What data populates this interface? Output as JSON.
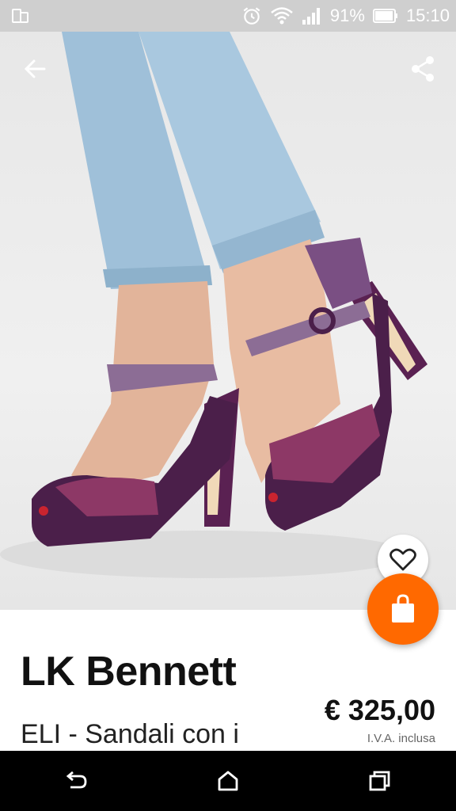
{
  "status_bar": {
    "battery_percent": "91%",
    "time": "15:10",
    "icons": [
      "screen-rotation-icon",
      "alarm-icon",
      "wifi-icon",
      "signal-icon",
      "battery-icon"
    ]
  },
  "toolbar": {
    "back_icon": "arrow-left-icon",
    "share_icon": "share-icon"
  },
  "actions": {
    "wishlist_icon": "heart-outline-icon",
    "cart_icon": "shopping-bag-icon"
  },
  "product": {
    "brand": "LK Bennett",
    "name": "ELI - Sandali con i",
    "price": "€ 325,00",
    "vat_note": "I.V.A. inclusa"
  },
  "nav_bar": {
    "icons": [
      "back-icon",
      "home-icon",
      "recents-icon"
    ]
  },
  "colors": {
    "accent": "#ff6900",
    "status_bar": "#cfcfcf",
    "nav_bar": "#000000"
  }
}
